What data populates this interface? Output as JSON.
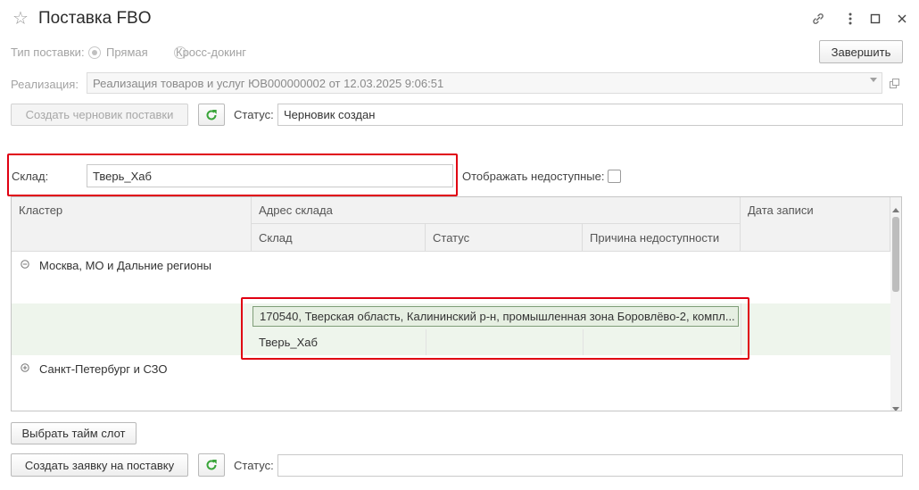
{
  "window": {
    "title": "Поставка FBO",
    "icons": [
      "star-icon",
      "link-icon",
      "more-icon",
      "maximize-icon",
      "close-icon"
    ]
  },
  "supply_type": {
    "label": "Тип поставки:",
    "options": [
      {
        "label": "Прямая",
        "selected": true
      },
      {
        "label": "Кросс-докинг",
        "selected": false
      }
    ]
  },
  "finish_button": "Завершить",
  "realization": {
    "label": "Реализация:",
    "value": "Реализация товаров и услуг ЮВ000000002 от 12.03.2025 9:06:51"
  },
  "draft": {
    "create_button": "Создать черновик поставки",
    "status_label": "Статус:",
    "status_value": "Черновик создан"
  },
  "warehouse": {
    "label": "Склад:",
    "value": "Тверь_Хаб",
    "show_unavailable_label": "Отображать недоступные:",
    "show_unavailable_checked": false
  },
  "table": {
    "headers": {
      "cluster": "Кластер",
      "address": "Адрес склада",
      "date": "Дата записи",
      "warehouse": "Склад",
      "status": "Статус",
      "reason": "Причина недоступности"
    },
    "groups": [
      {
        "name": "Москва, МО и Дальние регионы",
        "expanded": true
      },
      {
        "name": "Санкт-Петербург и СЗО",
        "expanded": false
      }
    ],
    "row": {
      "address": "170540, Тверская область, Калининский р-н, промышленная зона Боровлёво-2, компл...",
      "warehouse": "Тверь_Хаб",
      "status": "",
      "reason": ""
    }
  },
  "timeslot_button": "Выбрать тайм слот",
  "request": {
    "create_button": "Создать заявку на поставку",
    "status_label": "Статус:",
    "status_value": ""
  },
  "colors": {
    "highlight": "#e00012",
    "selected_row": "#eef5ec",
    "refresh_icon": "#3aa53a"
  }
}
